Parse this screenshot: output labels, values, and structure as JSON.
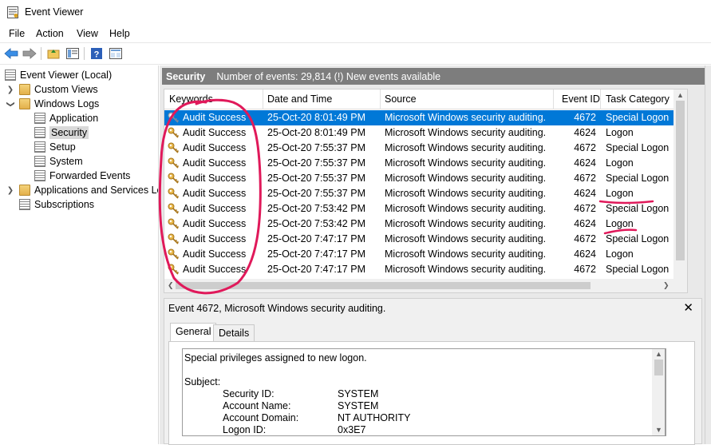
{
  "window": {
    "title": "Event Viewer",
    "icon": "event-viewer-icon"
  },
  "menu": [
    "File",
    "Action",
    "View",
    "Help"
  ],
  "toolbar": [
    "back-arrow-icon",
    "forward-arrow-icon",
    "up-folder-icon",
    "show-hide-tree-icon",
    "help-icon",
    "properties-pane-icon"
  ],
  "tree": {
    "root": "Event Viewer (Local)",
    "custom_views": "Custom Views",
    "windows_logs": "Windows Logs",
    "application": "Application",
    "security": "Security",
    "setup": "Setup",
    "system": "System",
    "forwarded": "Forwarded Events",
    "apps_services": "Applications and Services Lo",
    "subscriptions": "Subscriptions"
  },
  "header": {
    "name": "Security",
    "info": "Number of events: 29,814 (!) New events available"
  },
  "columns": {
    "keywords": "Keywords",
    "date": "Date and Time",
    "source": "Source",
    "event_id": "Event ID",
    "task": "Task Category"
  },
  "rows": [
    {
      "keywords": "Audit Success",
      "date": "25-Oct-20 8:01:49 PM",
      "source": "Microsoft Windows security auditing.",
      "event_id": "4672",
      "task": "Special Logon"
    },
    {
      "keywords": "Audit Success",
      "date": "25-Oct-20 8:01:49 PM",
      "source": "Microsoft Windows security auditing.",
      "event_id": "4624",
      "task": "Logon"
    },
    {
      "keywords": "Audit Success",
      "date": "25-Oct-20 7:55:37 PM",
      "source": "Microsoft Windows security auditing.",
      "event_id": "4672",
      "task": "Special Logon"
    },
    {
      "keywords": "Audit Success",
      "date": "25-Oct-20 7:55:37 PM",
      "source": "Microsoft Windows security auditing.",
      "event_id": "4624",
      "task": "Logon"
    },
    {
      "keywords": "Audit Success",
      "date": "25-Oct-20 7:55:37 PM",
      "source": "Microsoft Windows security auditing.",
      "event_id": "4672",
      "task": "Special Logon"
    },
    {
      "keywords": "Audit Success",
      "date": "25-Oct-20 7:55:37 PM",
      "source": "Microsoft Windows security auditing.",
      "event_id": "4624",
      "task": "Logon"
    },
    {
      "keywords": "Audit Success",
      "date": "25-Oct-20 7:53:42 PM",
      "source": "Microsoft Windows security auditing.",
      "event_id": "4672",
      "task": "Special Logon"
    },
    {
      "keywords": "Audit Success",
      "date": "25-Oct-20 7:53:42 PM",
      "source": "Microsoft Windows security auditing.",
      "event_id": "4624",
      "task": "Logon"
    },
    {
      "keywords": "Audit Success",
      "date": "25-Oct-20 7:47:17 PM",
      "source": "Microsoft Windows security auditing.",
      "event_id": "4672",
      "task": "Special Logon"
    },
    {
      "keywords": "Audit Success",
      "date": "25-Oct-20 7:47:17 PM",
      "source": "Microsoft Windows security auditing.",
      "event_id": "4624",
      "task": "Logon"
    },
    {
      "keywords": "Audit Success",
      "date": "25-Oct-20 7:47:17 PM",
      "source": "Microsoft Windows security auditing.",
      "event_id": "4672",
      "task": "Special Logon"
    }
  ],
  "detail": {
    "title": "Event 4672, Microsoft Windows security auditing.",
    "close": "✕",
    "tabs": [
      "General",
      "Details"
    ],
    "message": {
      "summary": "Special privileges assigned to new logon.",
      "subject": "Subject:",
      "fields": [
        {
          "label": "Security ID:",
          "value": "SYSTEM"
        },
        {
          "label": "Account Name:",
          "value": "SYSTEM"
        },
        {
          "label": "Account Domain:",
          "value": "NT AUTHORITY"
        },
        {
          "label": "Logon ID:",
          "value": "0x3E7"
        }
      ]
    }
  },
  "colors": {
    "selection": "#0078d7",
    "header_bg": "#7d7d7d",
    "annotation": "#e0195a"
  }
}
